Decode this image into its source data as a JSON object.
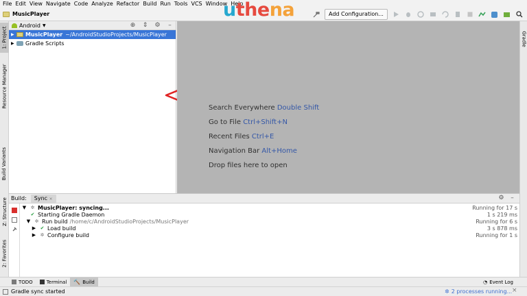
{
  "menu": [
    "File",
    "Edit",
    "View",
    "Navigate",
    "Code",
    "Analyze",
    "Refactor",
    "Build",
    "Run",
    "Tools",
    "VCS",
    "Window",
    "Help"
  ],
  "navbar": {
    "project": "MusicPlayer",
    "add_config": "Add Configuration..."
  },
  "logo": {
    "part1": "u",
    "part2": "the",
    "part3": "na"
  },
  "left_tabs": {
    "project": "1: Project",
    "resource_manager": "Resource Manager",
    "build_variants": "Build Variants",
    "structure": "Z: Structure",
    "favorites": "2: Favorites"
  },
  "right_tabs": {
    "gradle": "Gradle"
  },
  "project_panel": {
    "view": "Android",
    "items": [
      {
        "name": "MusicPlayer",
        "path": "~/AndroidStudioProjects/MusicPlayer"
      },
      {
        "name": "Gradle Scripts"
      }
    ]
  },
  "editor_hints": [
    {
      "label": "Search Everywhere",
      "key": "Double Shift"
    },
    {
      "label": "Go to File",
      "key": "Ctrl+Shift+N"
    },
    {
      "label": "Recent Files",
      "key": "Ctrl+E"
    },
    {
      "label": "Navigation Bar",
      "key": "Alt+Home"
    },
    {
      "label": "Drop files here to open",
      "key": ""
    }
  ],
  "build_panel": {
    "title": "Build:",
    "tab": "Sync",
    "rows": [
      {
        "text": "MusicPlayer: syncing...",
        "extra": "",
        "time": "Running for 17 s"
      },
      {
        "text": "Starting Gradle Daemon",
        "extra": "",
        "time": "1 s 219 ms"
      },
      {
        "text": "Run build",
        "extra": "/home/c/AndroidStudioProjects/MusicPlayer",
        "time": "Running for 6 s"
      },
      {
        "text": "Load build",
        "extra": "",
        "time": "3 s 878 ms"
      },
      {
        "text": "Configure build",
        "extra": "",
        "time": "Running for 1 s"
      }
    ]
  },
  "bottom_tabs": {
    "todo": "TODO",
    "terminal": "Terminal",
    "build": "Build",
    "event_log": "Event Log"
  },
  "status": {
    "message": "Gradle sync started",
    "processes": "2 processes running..."
  }
}
